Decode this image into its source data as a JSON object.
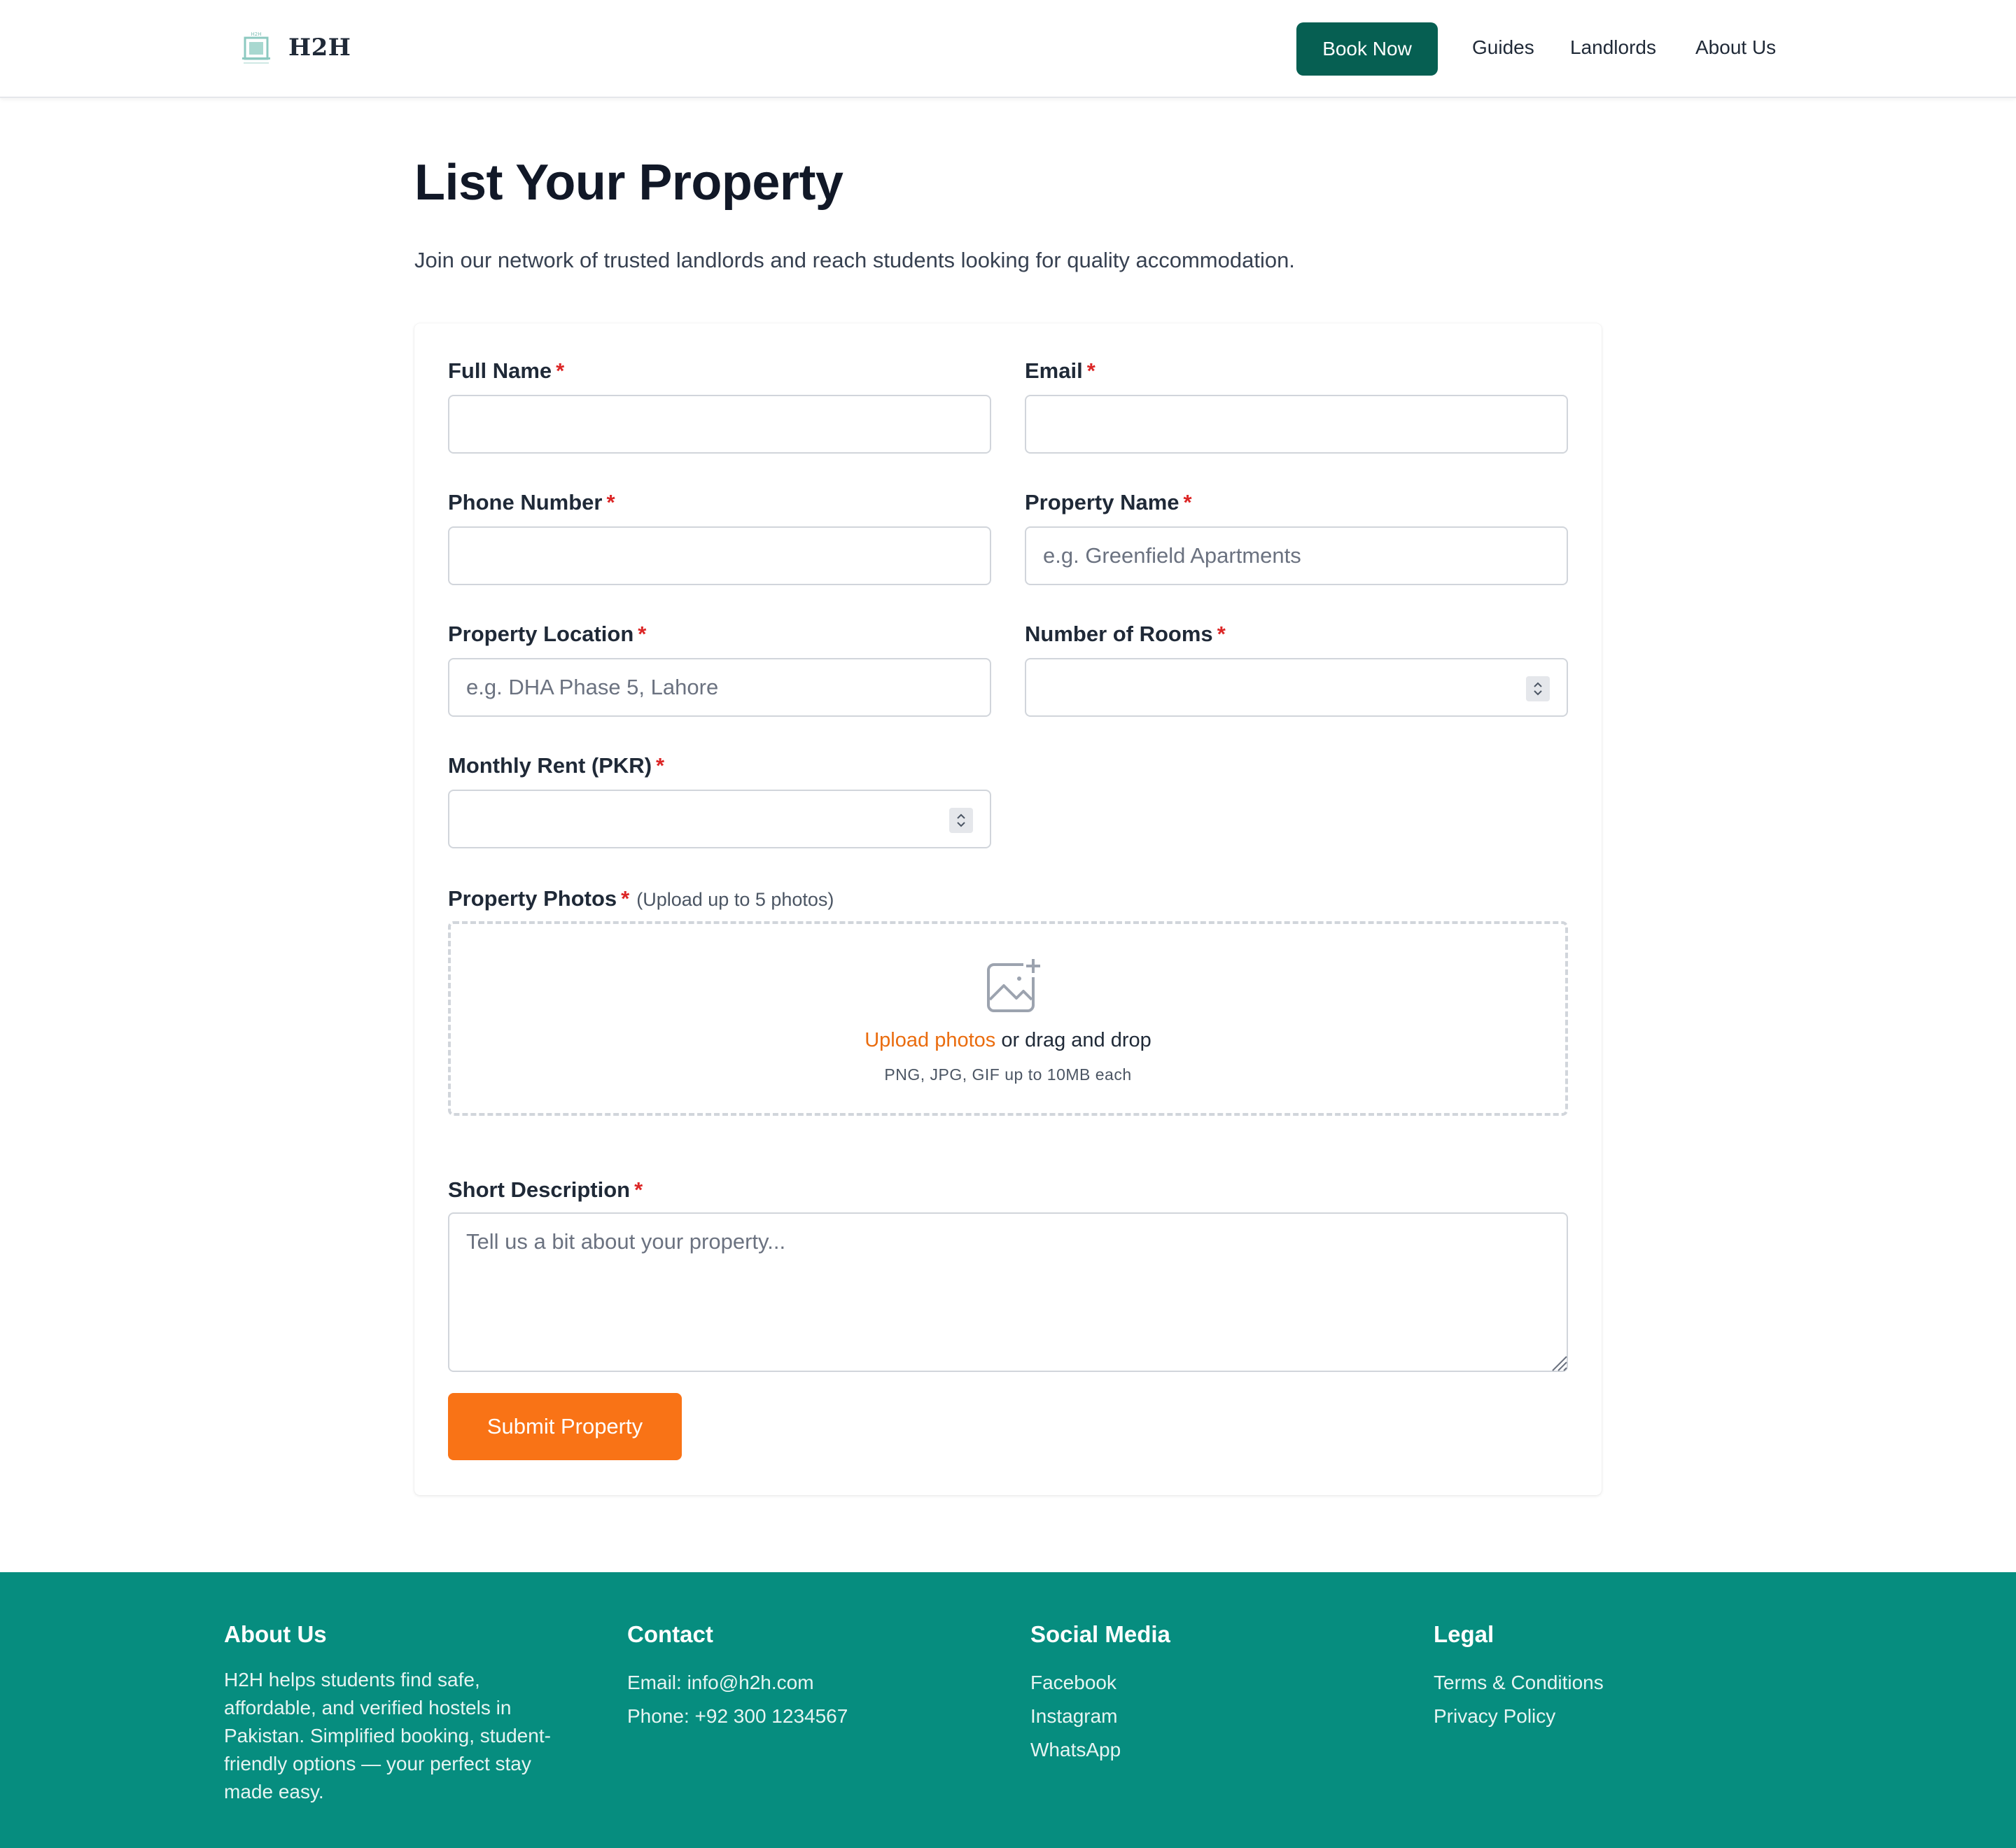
{
  "header": {
    "brand": "H2H",
    "logo_text": "H2H",
    "book_now": "Book Now",
    "nav": [
      "Guides",
      "Landlords",
      "About Us"
    ]
  },
  "page": {
    "title": "List Your Property",
    "subtitle": "Join our network of trusted landlords and reach students looking for quality accommodation."
  },
  "form": {
    "required_mark": "*",
    "full_name": {
      "label": "Full Name",
      "value": "",
      "placeholder": ""
    },
    "email": {
      "label": "Email",
      "value": "",
      "placeholder": ""
    },
    "phone": {
      "label": "Phone Number",
      "value": "",
      "placeholder": ""
    },
    "property_name": {
      "label": "Property Name",
      "value": "",
      "placeholder": "e.g. Greenfield Apartments"
    },
    "property_location": {
      "label": "Property Location",
      "value": "",
      "placeholder": "e.g. DHA Phase 5, Lahore"
    },
    "rooms": {
      "label": "Number of Rooms",
      "value": "",
      "placeholder": ""
    },
    "rent": {
      "label": "Monthly Rent (PKR)",
      "value": "",
      "placeholder": ""
    },
    "photos": {
      "label": "Property Photos",
      "hint": "(Upload up to 5 photos)",
      "upload_link": "Upload photos",
      "upload_rest": " or drag and drop",
      "note": "PNG, JPG, GIF up to 10MB each",
      "icon": "image-plus-icon"
    },
    "description": {
      "label": "Short Description",
      "value": "",
      "placeholder": "Tell us a bit about your property..."
    },
    "submit": "Submit Property"
  },
  "footer": {
    "about": {
      "title": "About Us",
      "text_lines": [
        "H2H helps students find safe,",
        "affordable, and verified hostels in",
        "Pakistan. Simplified booking, student-",
        "friendly options — your perfect stay",
        "made easy."
      ]
    },
    "contact": {
      "title": "Contact",
      "email": "Email: info@h2h.com",
      "phone": "Phone: +92 300 1234567"
    },
    "social": {
      "title": "Social Media",
      "links": [
        "Facebook",
        "Instagram",
        "WhatsApp"
      ]
    },
    "legal": {
      "title": "Legal",
      "links": [
        "Terms & Conditions",
        "Privacy Policy"
      ]
    }
  },
  "colors": {
    "primary_dark": "#065f52",
    "footer_teal": "#068d7f",
    "accent_orange": "#f97316",
    "required_red": "#dc2626"
  }
}
